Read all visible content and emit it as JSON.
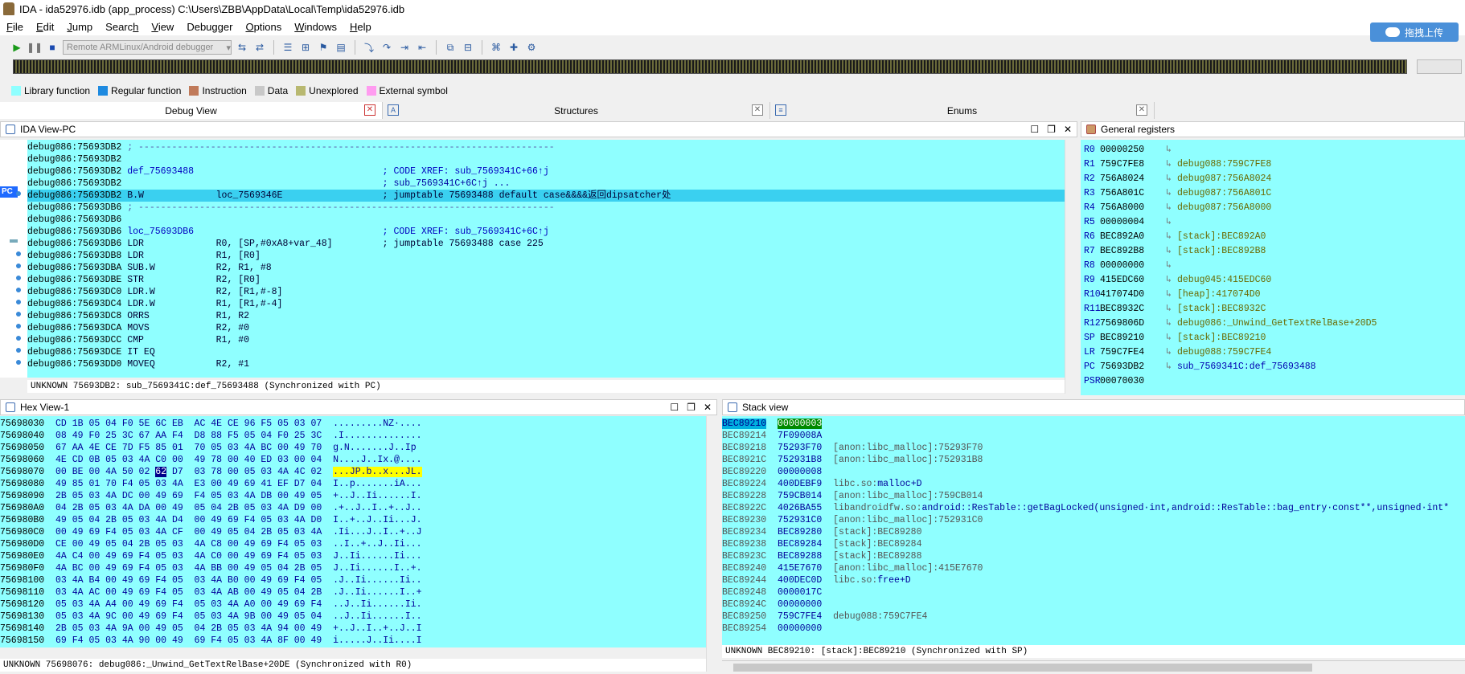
{
  "window": {
    "title": "IDA - ida52976.idb (app_process) C:\\Users\\ZBB\\AppData\\Local\\Temp\\ida52976.idb"
  },
  "menu": [
    {
      "pre": "",
      "u": "F",
      "post": "ile"
    },
    {
      "pre": "",
      "u": "E",
      "post": "dit"
    },
    {
      "pre": "",
      "u": "J",
      "post": "ump"
    },
    {
      "pre": "Searc",
      "u": "h",
      "post": ""
    },
    {
      "pre": "",
      "u": "V",
      "post": "iew"
    },
    {
      "pre": "Debu",
      "u": "g",
      "post": "ger"
    },
    {
      "pre": "",
      "u": "O",
      "post": "ptions"
    },
    {
      "pre": "",
      "u": "W",
      "post": "indows"
    },
    {
      "pre": "",
      "u": "H",
      "post": "elp"
    }
  ],
  "upload": {
    "label": "拖拽上传"
  },
  "toolbar": {
    "debugger": "Remote ARMLinux/Android debugger"
  },
  "legend": [
    {
      "label": "Library function",
      "color": "#8fffff"
    },
    {
      "label": "Regular function",
      "color": "#1e8ae0"
    },
    {
      "label": "Instruction",
      "color": "#c07a5a"
    },
    {
      "label": "Data",
      "color": "#c8c8c8"
    },
    {
      "label": "Unexplored",
      "color": "#b8b870"
    },
    {
      "label": "External symbol",
      "color": "#ff9cf0"
    }
  ],
  "tabs": {
    "debug_view": "Debug View",
    "structures": "Structures",
    "enums": "Enums"
  },
  "ida_view": {
    "title": "IDA View-PC",
    "pc_label": "PC",
    "lines": [
      {
        "a": "debug086:75693DB2",
        "t": " ; ---------------------------------------------------------------------------",
        "k": "dash"
      },
      {
        "a": "debug086:75693DB2",
        "t": "",
        "k": ""
      },
      {
        "a": "debug086:75693DB2",
        "t": " def_75693488                                  ; CODE XREF: sub_7569341C+66↑j",
        "k": "lbl"
      },
      {
        "a": "debug086:75693DB2",
        "t": "                                               ; sub_7569341C+6C↑j ...",
        "k": "cmt"
      },
      {
        "a": "debug086:75693DB2",
        "t": " B.W             loc_7569346E                  ; jumptable 75693488 default case&&&&返回dipsatcher处",
        "k": "sel"
      },
      {
        "a": "debug086:75693DB6",
        "t": " ; ---------------------------------------------------------------------------",
        "k": "dash"
      },
      {
        "a": "debug086:75693DB6",
        "t": "",
        "k": ""
      },
      {
        "a": "debug086:75693DB6",
        "t": " loc_75693DB6                                  ; CODE XREF: sub_7569341C+6C↑j",
        "k": "lbl"
      },
      {
        "a": "debug086:75693DB6",
        "t": " LDR             R0, [SP,#0xA8+var_48]         ; jumptable 75693488 case 225",
        "k": ""
      },
      {
        "a": "debug086:75693DB8",
        "t": " LDR             R1, [R0]",
        "k": ""
      },
      {
        "a": "debug086:75693DBA",
        "t": " SUB.W           R2, R1, #8",
        "k": ""
      },
      {
        "a": "debug086:75693DBE",
        "t": " STR             R2, [R0]",
        "k": ""
      },
      {
        "a": "debug086:75693DC0",
        "t": " LDR.W           R2, [R1,#-8]",
        "k": ""
      },
      {
        "a": "debug086:75693DC4",
        "t": " LDR.W           R1, [R1,#-4]",
        "k": ""
      },
      {
        "a": "debug086:75693DC8",
        "t": " ORRS            R1, R2",
        "k": ""
      },
      {
        "a": "debug086:75693DCA",
        "t": " MOVS            R2, #0",
        "k": ""
      },
      {
        "a": "debug086:75693DCC",
        "t": " CMP             R1, #0",
        "k": ""
      },
      {
        "a": "debug086:75693DCE",
        "t": " IT EQ",
        "k": ""
      },
      {
        "a": "debug086:75693DD0",
        "t": " MOVEQ           R2, #1",
        "k": ""
      }
    ],
    "status": "UNKNOWN 75693DB2: sub_7569341C:def_75693488 (Synchronized with PC)"
  },
  "registers": {
    "title": "General registers",
    "rows": [
      {
        "n": "R0",
        "v": "00000250",
        "t": ""
      },
      {
        "n": "R1",
        "v": "759C7FE8",
        "t": "debug088:759C7FE8"
      },
      {
        "n": "R2",
        "v": "756A8024",
        "t": "debug087:756A8024"
      },
      {
        "n": "R3",
        "v": "756A801C",
        "t": "debug087:756A801C"
      },
      {
        "n": "R4",
        "v": "756A8000",
        "t": "debug087:756A8000"
      },
      {
        "n": "R5",
        "v": "00000004",
        "t": ""
      },
      {
        "n": "R6",
        "v": "BEC892A0",
        "t": "[stack]:BEC892A0"
      },
      {
        "n": "R7",
        "v": "BEC892B8",
        "t": "[stack]:BEC892B8"
      },
      {
        "n": "R8",
        "v": "00000000",
        "t": ""
      },
      {
        "n": "R9",
        "v": "415EDC60",
        "t": "debug045:415EDC60"
      },
      {
        "n": "R10",
        "v": "417074D0",
        "t": "[heap]:417074D0"
      },
      {
        "n": "R11",
        "v": "BEC8932C",
        "t": "[stack]:BEC8932C"
      },
      {
        "n": "R12",
        "v": "7569806D",
        "t": "debug086:_Unwind_GetTextRelBase+20D5"
      },
      {
        "n": "SP",
        "v": "BEC89210",
        "t": "[stack]:BEC89210"
      },
      {
        "n": "LR",
        "v": "759C7FE4",
        "t": "debug088:759C7FE4"
      },
      {
        "n": "PC",
        "v": "75693DB2",
        "t": "sub_7569341C:def_75693488"
      },
      {
        "n": "PSR",
        "v": "00070030",
        "t": "",
        "noarrow": true
      }
    ]
  },
  "hex_view": {
    "title": "Hex View-1",
    "rows": [
      {
        "a": "75698030",
        "b": "CD 1B 05 04 F0 5E 6C EB  AC 4E CE 96 F5 05 03 07",
        "s": ".........NZ·...."
      },
      {
        "a": "75698040",
        "b": "08 49 F0 25 3C 67 AA F4  D8 88 F5 05 04 F0 25 3C",
        "s": ".I.............."
      },
      {
        "a": "75698050",
        "b": "67 AA 4E CE 7D F5 85 01  70 05 03 4A BC 00 49 70",
        "s": "g.N.......J..Ip"
      },
      {
        "a": "75698060",
        "b": "4E CD 0B 05 03 4A C0 00  49 78 00 40 ED 03 00 04",
        "s": "N....J..Ix.@...."
      },
      {
        "a": "75698070",
        "b": "00 BE 00 4A 50 02 ",
        "cur": "62",
        "b2": " D7  03 78 00 05 03 4A 4C 02",
        "s": "...JP.b..x...JL.",
        "hl": true
      },
      {
        "a": "75698080",
        "b": "49 85 01 70 F4 05 03 4A  E3 00 49 69 41 EF D7 04",
        "s": "I..p.......iA..."
      },
      {
        "a": "75698090",
        "b": "2B 05 03 4A DC 00 49 69  F4 05 03 4A DB 00 49 05",
        "s": "+..J..Ii......I."
      },
      {
        "a": "756980A0",
        "b": "04 2B 05 03 4A DA 00 49  05 04 2B 05 03 4A D9 00",
        "s": ".+..J..I..+..J.."
      },
      {
        "a": "756980B0",
        "b": "49 05 04 2B 05 03 4A D4  00 49 69 F4 05 03 4A D0",
        "s": "I..+..J..Ii...J."
      },
      {
        "a": "756980C0",
        "b": "00 49 69 F4 05 03 4A CF  00 49 05 04 2B 05 03 4A",
        "s": ".Ii...J..I..+..J"
      },
      {
        "a": "756980D0",
        "b": "CE 00 49 05 04 2B 05 03  4A C8 00 49 69 F4 05 03",
        "s": "..I..+..J..Ii..."
      },
      {
        "a": "756980E0",
        "b": "4A C4 00 49 69 F4 05 03  4A C0 00 49 69 F4 05 03",
        "s": "J..Ii......Ii..."
      },
      {
        "a": "756980F0",
        "b": "4A BC 00 49 69 F4 05 03  4A BB 00 49 05 04 2B 05",
        "s": "J..Ii......I..+."
      },
      {
        "a": "75698100",
        "b": "03 4A B4 00 49 69 F4 05  03 4A B0 00 49 69 F4 05",
        "s": ".J..Ii......Ii.."
      },
      {
        "a": "75698110",
        "b": "03 4A AC 00 49 69 F4 05  03 4A AB 00 49 05 04 2B",
        "s": ".J..Ii......I..+"
      },
      {
        "a": "75698120",
        "b": "05 03 4A A4 00 49 69 F4  05 03 4A A0 00 49 69 F4",
        "s": "..J..Ii......Ii."
      },
      {
        "a": "75698130",
        "b": "05 03 4A 9C 00 49 69 F4  05 03 4A 9B 00 49 05 04",
        "s": "..J..Ii......I.."
      },
      {
        "a": "75698140",
        "b": "2B 05 03 4A 9A 00 49 05  04 2B 05 03 4A 94 00 49",
        "s": "+..J..I..+..J..I"
      },
      {
        "a": "75698150",
        "b": "69 F4 05 03 4A 90 00 49  69 F4 05 03 4A 8F 00 49",
        "s": "i.....J..Ii....I"
      }
    ],
    "status": "UNKNOWN 75698076: debug086:_Unwind_GetTextRelBase+20DE (Synchronized with R0)"
  },
  "stack_view": {
    "title": "Stack view",
    "rows": [
      {
        "a": "BEC89210",
        "v": "00000003",
        "c": "",
        "cur": true
      },
      {
        "a": "BEC89214",
        "v": "7F09008A",
        "c": ""
      },
      {
        "a": "BEC89218",
        "v": "75293F70",
        "c": "[anon:libc_malloc]:75293F70"
      },
      {
        "a": "BEC8921C",
        "v": "752931B8",
        "c": "[anon:libc_malloc]:752931B8"
      },
      {
        "a": "BEC89220",
        "v": "00000008",
        "c": ""
      },
      {
        "a": "BEC89224",
        "v": "400DEBF9",
        "c": "libc.so:",
        "c2": "malloc+D"
      },
      {
        "a": "BEC89228",
        "v": "759CB014",
        "c": "[anon:libc_malloc]:759CB014"
      },
      {
        "a": "BEC8922C",
        "v": "4026BA55",
        "c": "libandroidfw.so:",
        "c2": "android::ResTable::getBagLocked(unsigned·int,android::ResTable::bag_entry·const**,unsigned·int*"
      },
      {
        "a": "BEC89230",
        "v": "752931C0",
        "c": "[anon:libc_malloc]:752931C0"
      },
      {
        "a": "BEC89234",
        "v": "BEC89280",
        "c": "[stack]:BEC89280"
      },
      {
        "a": "BEC89238",
        "v": "BEC89284",
        "c": "[stack]:BEC89284"
      },
      {
        "a": "BEC8923C",
        "v": "BEC89288",
        "c": "[stack]:BEC89288"
      },
      {
        "a": "BEC89240",
        "v": "415E7670",
        "c": "[anon:libc_malloc]:415E7670"
      },
      {
        "a": "BEC89244",
        "v": "400DEC0D",
        "c": "libc.so:",
        "c2": "free+D"
      },
      {
        "a": "BEC89248",
        "v": "0000017C",
        "c": ""
      },
      {
        "a": "BEC8924C",
        "v": "00000000",
        "c": ""
      },
      {
        "a": "BEC89250",
        "v": "759C7FE4",
        "c": "debug088:759C7FE4"
      },
      {
        "a": "BEC89254",
        "v": "00000000",
        "c": ""
      }
    ],
    "status": "UNKNOWN BEC89210: [stack]:BEC89210 (Synchronized with SP)"
  }
}
